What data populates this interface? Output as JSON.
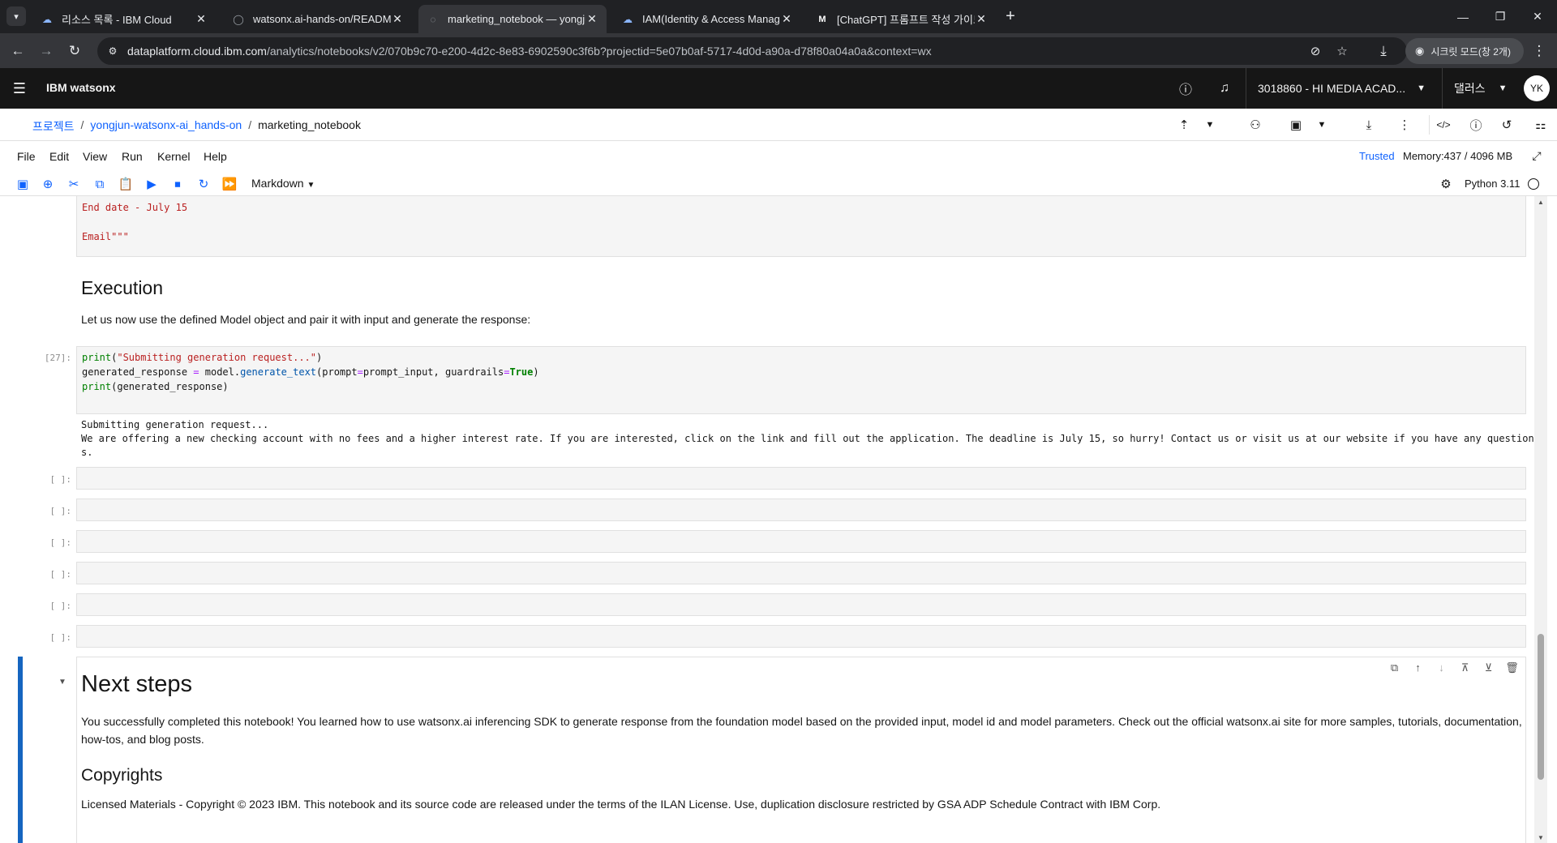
{
  "browser": {
    "tabs": [
      {
        "title": "리소스 목록 - IBM Cloud",
        "favicon": "ibm-cloud-icon"
      },
      {
        "title": "watsonx.ai-hands-on/README",
        "favicon": "github-icon"
      },
      {
        "title": "marketing_notebook — yongjun",
        "favicon": "watsonx-icon"
      },
      {
        "title": "IAM(Identity & Access Manag",
        "favicon": "ibm-cloud-icon"
      },
      {
        "title": "[ChatGPT] 프롬프트 작성 가이드",
        "favicon": "medium-icon"
      }
    ],
    "url_domain": "dataplatform.cloud.ibm.com",
    "url_path": "/analytics/notebooks/v2/070b9c70-e200-4d2c-8e83-6902590c3f6b?projectid=5e07b0af-5717-4d0d-a90a-d78f80a04a0a&context=wx",
    "incognito_label": "시크릿 모드(창 2개)"
  },
  "ibm_header": {
    "brand": "IBM watsonx",
    "account": "3018860 - HI MEDIA ACAD...",
    "region": "댈러스",
    "avatar": "YK"
  },
  "breadcrumb": {
    "root": "프로젝트",
    "project": "yongjun-watsonx-ai_hands-on",
    "current": "marketing_notebook"
  },
  "jupyter": {
    "menu": [
      "File",
      "Edit",
      "View",
      "Run",
      "Kernel",
      "Help"
    ],
    "trusted": "Trusted",
    "memory": "Memory:437 / 4096 MB",
    "cell_type": "Markdown",
    "kernel": "Python 3.11"
  },
  "cells": {
    "prev_code_tail": [
      "End date - July 15",
      "",
      "Email\"\"\""
    ],
    "execution_heading": "Execution",
    "execution_text": "Let us now use the defined Model object and pair it with input and generate the response:",
    "run_prompt": "[27]:",
    "code": {
      "line1_print": "print",
      "line1_str": "\"Submitting generation request...\"",
      "line2_var": "generated_response ",
      "line2_eq": "=",
      "line2_obj": " model.",
      "line2_fn": "generate_text",
      "line2_args1": "(prompt",
      "line2_eq2": "=",
      "line2_args2": "prompt_input, guardrails",
      "line2_eq3": "=",
      "line2_true": "True",
      "line2_close": ")",
      "line3_print": "print",
      "line3_rest": "(generated_response)"
    },
    "output": [
      "Submitting generation request...",
      "We are offering a new checking account with no fees and a higher interest rate. If you are interested, click on the link and fill out the application. The deadline is July 15, so hurry! Contact us or visit us at our website if you have any question",
      "s."
    ],
    "empty_prompt": "[ ]:",
    "next_steps_heading": "Next steps",
    "next_steps_text": "You successfully completed this notebook! You learned how to use watsonx.ai inferencing SDK to generate response from the foundation model based on the provided input, model id and model parameters. Check out the official watsonx.ai site for more samples, tutorials, documentation, how-tos, and blog posts.",
    "copyrights_heading": "Copyrights",
    "copyrights_text": "Licensed Materials - Copyright © 2023 IBM. This notebook and its source code are released under the terms of the ILAN License. Use, duplication disclosure restricted by GSA ADP Schedule Contract with IBM Corp."
  },
  "colors": {
    "ibm_blue": "#0f62fe",
    "selection_bar": "#1565c0",
    "header_bg": "#161616"
  }
}
